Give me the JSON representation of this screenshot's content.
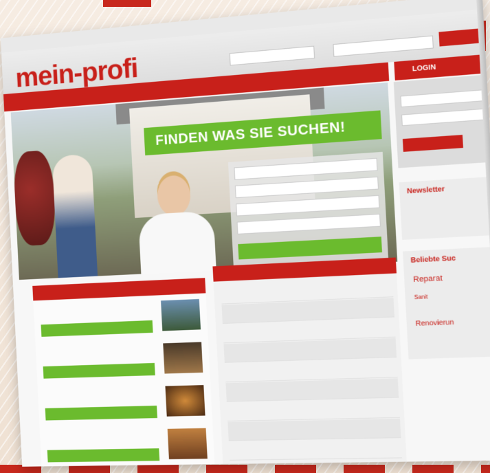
{
  "logo": {
    "text": "mein-profi"
  },
  "hero": {
    "banner": "FINDEN WAS SIE SUCHEN!"
  },
  "login": {
    "title": "LOGIN"
  },
  "sidebar": {
    "newsletter_title": "Newsletter",
    "beliebte_title": "Beliebte Suc",
    "beliebte_items": [
      "Reparat",
      "Sanit",
      "Renovierun"
    ]
  },
  "colors": {
    "accent": "#c8201a",
    "green": "#6bbb2e"
  }
}
